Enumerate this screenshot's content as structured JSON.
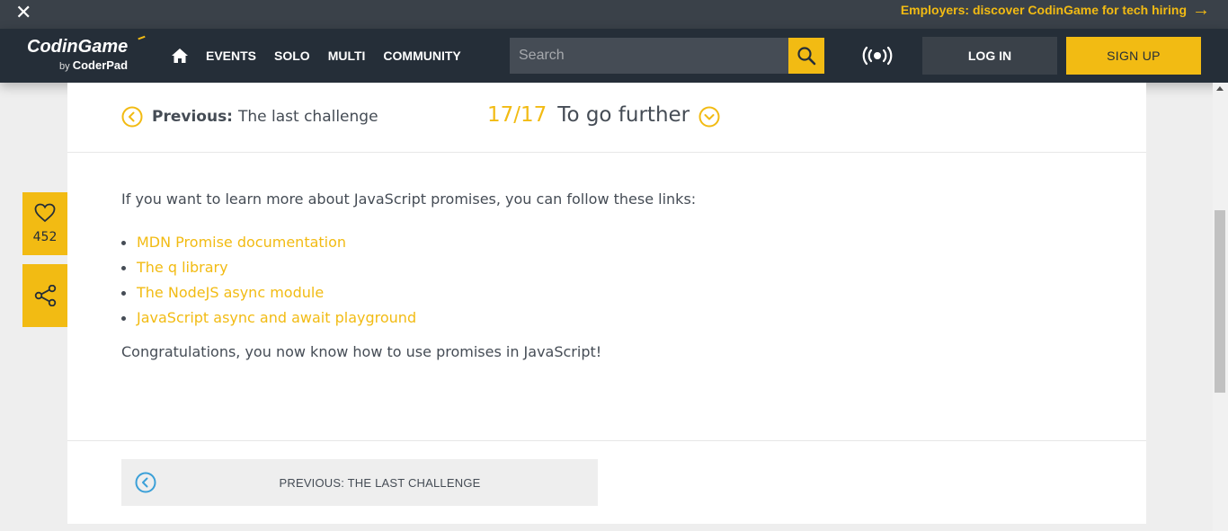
{
  "promo": {
    "close_icon": "close-icon",
    "text": "Employers: discover CodinGame for tech hiring",
    "arrow": "→"
  },
  "logo": {
    "brand": "CodinGame",
    "by": "by",
    "coderpad": "CoderPad"
  },
  "nav": {
    "home_icon": "home-icon",
    "links": [
      "EVENTS",
      "SOLO",
      "MULTI",
      "COMMUNITY"
    ],
    "search_placeholder": "Search",
    "search_icon": "search-icon",
    "live_icon": "broadcast-icon",
    "login": "LOG IN",
    "signup": "SIGN UP"
  },
  "lesson": {
    "previous_label": "Previous:",
    "previous_title": "The last challenge",
    "counter": "17/17",
    "title": "To go further",
    "intro": "If you want to learn more about JavaScript promises, you can follow these links:",
    "links": [
      "MDN Promise documentation",
      "The q library",
      "The NodeJS async module",
      "JavaScript async and await playground"
    ],
    "outro": "Congratulations, you now know how to use promises in JavaScript!",
    "footer_previous": "PREVIOUS: THE LAST CHALLENGE"
  },
  "side": {
    "likes": "452",
    "like_icon": "heart-icon",
    "share_icon": "share-icon"
  },
  "colors": {
    "accent": "#f2bb13",
    "nav_bg": "#252e38",
    "banner_bg": "#3a4149",
    "text": "#454c55",
    "footer_circle": "#3ba0d8"
  }
}
